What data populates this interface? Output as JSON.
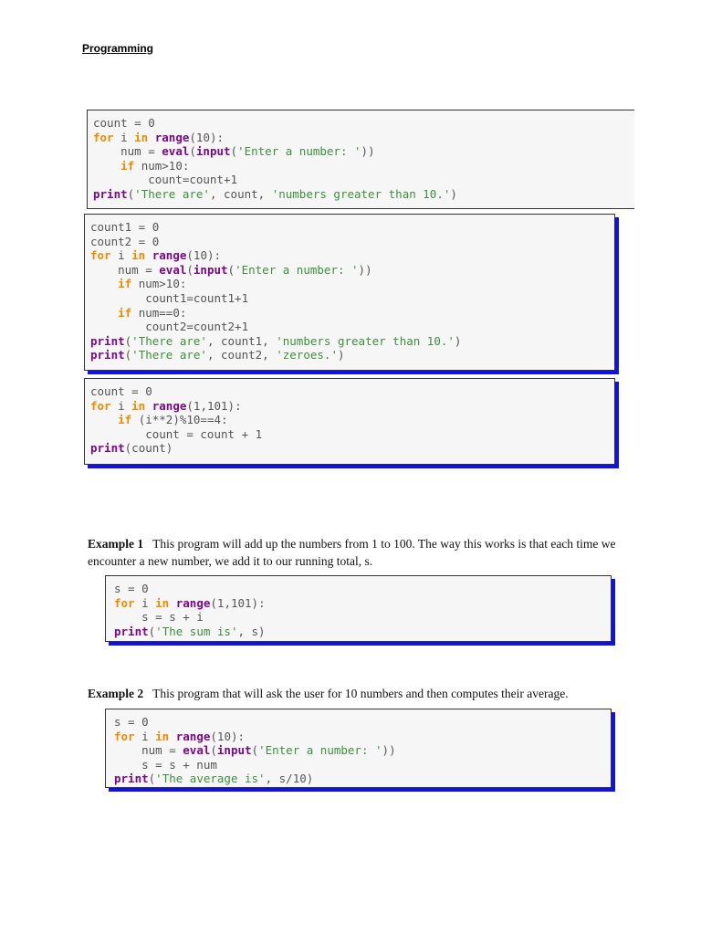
{
  "title": "Programming",
  "code_blocks": [
    {
      "lines": [
        [
          [
            "tx",
            "count = 0"
          ]
        ],
        [
          [
            "kw",
            "for"
          ],
          [
            "tx",
            " i "
          ],
          [
            "kw",
            "in"
          ],
          [
            "tx",
            " "
          ],
          [
            "bi",
            "range"
          ],
          [
            "tx",
            "(10):"
          ]
        ],
        [
          [
            "tx",
            "    num = "
          ],
          [
            "bi",
            "eval"
          ],
          [
            "tx",
            "("
          ],
          [
            "bi",
            "input"
          ],
          [
            "tx",
            "("
          ],
          [
            "st",
            "'Enter a number: '"
          ],
          [
            "tx",
            "))"
          ]
        ],
        [
          [
            "tx",
            "    "
          ],
          [
            "kw",
            "if"
          ],
          [
            "tx",
            " num>10:"
          ]
        ],
        [
          [
            "tx",
            "        count=count+1"
          ]
        ],
        [
          [
            "bi",
            "print"
          ],
          [
            "tx",
            "("
          ],
          [
            "st",
            "'There are'"
          ],
          [
            "tx",
            ", count, "
          ],
          [
            "st",
            "'numbers greater than 10.'"
          ],
          [
            "tx",
            ")"
          ]
        ]
      ]
    },
    {
      "lines": [
        [
          [
            "tx",
            "count1 = 0"
          ]
        ],
        [
          [
            "tx",
            "count2 = 0"
          ]
        ],
        [
          [
            "kw",
            "for"
          ],
          [
            "tx",
            " i "
          ],
          [
            "kw",
            "in"
          ],
          [
            "tx",
            " "
          ],
          [
            "bi",
            "range"
          ],
          [
            "tx",
            "(10):"
          ]
        ],
        [
          [
            "tx",
            "    num = "
          ],
          [
            "bi",
            "eval"
          ],
          [
            "tx",
            "("
          ],
          [
            "bi",
            "input"
          ],
          [
            "tx",
            "("
          ],
          [
            "st",
            "'Enter a number: '"
          ],
          [
            "tx",
            "))"
          ]
        ],
        [
          [
            "tx",
            "    "
          ],
          [
            "kw",
            "if"
          ],
          [
            "tx",
            " num>10:"
          ]
        ],
        [
          [
            "tx",
            "        count1=count1+1"
          ]
        ],
        [
          [
            "tx",
            "    "
          ],
          [
            "kw",
            "if"
          ],
          [
            "tx",
            " num==0:"
          ]
        ],
        [
          [
            "tx",
            "        count2=count2+1"
          ]
        ],
        [
          [
            "bi",
            "print"
          ],
          [
            "tx",
            "("
          ],
          [
            "st",
            "'There are'"
          ],
          [
            "tx",
            ", count1, "
          ],
          [
            "st",
            "'numbers greater than 10.'"
          ],
          [
            "tx",
            ")"
          ]
        ],
        [
          [
            "bi",
            "print"
          ],
          [
            "tx",
            "("
          ],
          [
            "st",
            "'There are'"
          ],
          [
            "tx",
            ", count2, "
          ],
          [
            "st",
            "'zeroes.'"
          ],
          [
            "tx",
            ")"
          ]
        ]
      ]
    },
    {
      "lines": [
        [
          [
            "tx",
            "count = 0"
          ]
        ],
        [
          [
            "kw",
            "for"
          ],
          [
            "tx",
            " i "
          ],
          [
            "kw",
            "in"
          ],
          [
            "tx",
            " "
          ],
          [
            "bi",
            "range"
          ],
          [
            "tx",
            "(1,101):"
          ]
        ],
        [
          [
            "tx",
            "    "
          ],
          [
            "kw",
            "if"
          ],
          [
            "tx",
            " (i**2)%10==4:"
          ]
        ],
        [
          [
            "tx",
            "        count = count + 1"
          ]
        ],
        [
          [
            "bi",
            "print"
          ],
          [
            "tx",
            "(count)"
          ]
        ]
      ]
    },
    {
      "lines": [
        [
          [
            "tx",
            "s = 0"
          ]
        ],
        [
          [
            "kw",
            "for"
          ],
          [
            "tx",
            " i "
          ],
          [
            "kw",
            "in"
          ],
          [
            "tx",
            " "
          ],
          [
            "bi",
            "range"
          ],
          [
            "tx",
            "(1,101):"
          ]
        ],
        [
          [
            "tx",
            "    s = s + i"
          ]
        ],
        [
          [
            "bi",
            "print"
          ],
          [
            "tx",
            "("
          ],
          [
            "st",
            "'The sum is'"
          ],
          [
            "tx",
            ", s)"
          ]
        ]
      ]
    },
    {
      "lines": [
        [
          [
            "tx",
            "s = 0"
          ]
        ],
        [
          [
            "kw",
            "for"
          ],
          [
            "tx",
            " i "
          ],
          [
            "kw",
            "in"
          ],
          [
            "tx",
            " "
          ],
          [
            "bi",
            "range"
          ],
          [
            "tx",
            "(10):"
          ]
        ],
        [
          [
            "tx",
            "    num = "
          ],
          [
            "bi",
            "eval"
          ],
          [
            "tx",
            "("
          ],
          [
            "bi",
            "input"
          ],
          [
            "tx",
            "("
          ],
          [
            "st",
            "'Enter a number: '"
          ],
          [
            "tx",
            "))"
          ]
        ],
        [
          [
            "tx",
            "    s = s + num"
          ]
        ],
        [
          [
            "bi",
            "print"
          ],
          [
            "tx",
            "("
          ],
          [
            "st",
            "'The average is'"
          ],
          [
            "tx",
            ", s/10)"
          ]
        ]
      ]
    }
  ],
  "examples": [
    {
      "label": "Example 1",
      "text": "This program will add up the numbers from 1 to 100. The way this works is that each time we encounter a new number, we add it to our running total, s."
    },
    {
      "label": "Example 2",
      "text": "This program that will ask the user for 10 numbers and then computes their average."
    }
  ]
}
